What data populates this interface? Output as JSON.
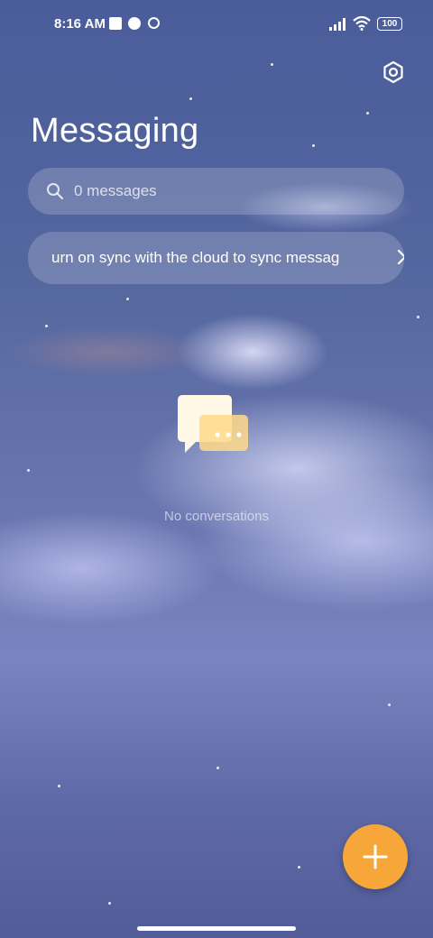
{
  "status_bar": {
    "time": "8:16 AM",
    "battery": "100"
  },
  "header": {
    "title": "Messaging",
    "settings_icon": "settings-hexagon-icon"
  },
  "search": {
    "placeholder": "0 messages",
    "icon": "search-icon"
  },
  "sync_banner": {
    "text": "urn on sync with the cloud to sync messag",
    "icon": "chevron-right-icon"
  },
  "empty_state": {
    "icon": "chat-bubbles-icon",
    "text": "No conversations"
  },
  "fab": {
    "icon": "plus-icon",
    "color": "#f7a63a"
  }
}
